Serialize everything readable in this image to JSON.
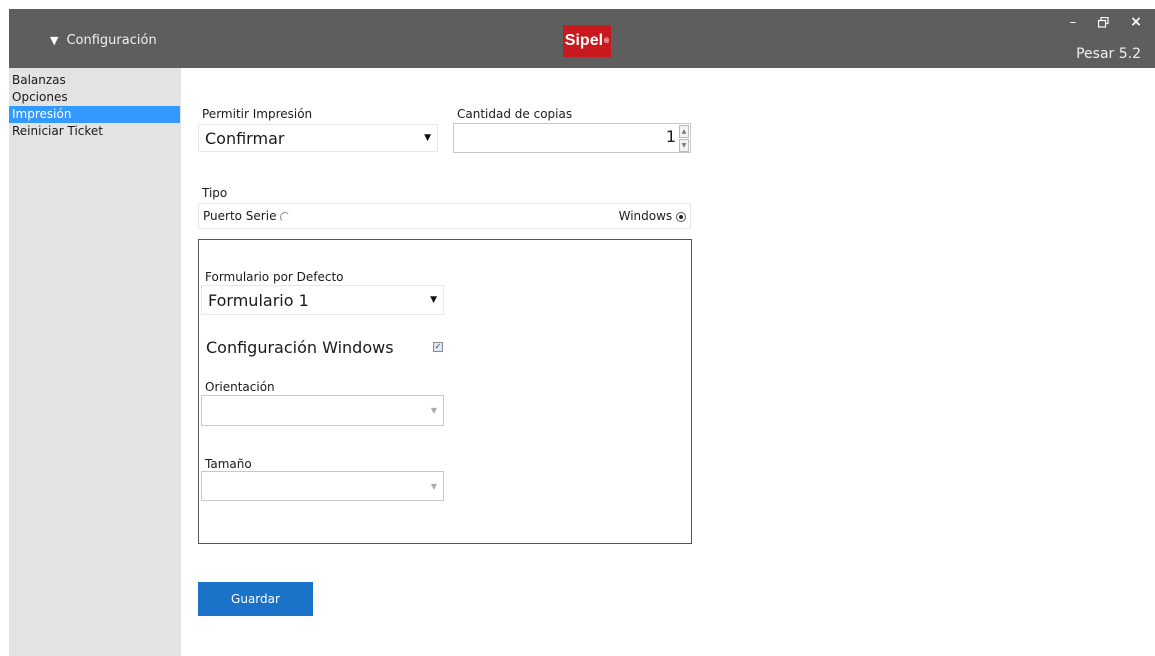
{
  "header": {
    "menu_label": "Configuración",
    "logo_text": "Sipel",
    "version": "Pesar 5.2",
    "window_controls": {
      "minimize": "–",
      "restore": "🗗",
      "close": "×"
    }
  },
  "sidebar": {
    "items": [
      {
        "label": "Balanzas"
      },
      {
        "label": "Opciones"
      },
      {
        "label": "Impresión"
      },
      {
        "label": "Reiniciar Ticket"
      }
    ],
    "active_index": 2
  },
  "form": {
    "permitir_impresion": {
      "label": "Permitir Impresión",
      "value": "Confirmar"
    },
    "cantidad_copias": {
      "label": "Cantidad de copias",
      "value": "1"
    },
    "tipo": {
      "label": "Tipo",
      "options": [
        {
          "label": "Puerto Serie",
          "selected": false
        },
        {
          "label": "Windows",
          "selected": true
        }
      ]
    },
    "formulario": {
      "label": "Formulario por Defecto",
      "value": "Formulario 1"
    },
    "configuracion_windows": {
      "label": "Configuración Windows",
      "checked": true
    },
    "orientacion": {
      "label": "Orientación",
      "value": ""
    },
    "tamano": {
      "label": "Tamaño",
      "value": ""
    }
  },
  "actions": {
    "save_label": "Guardar"
  },
  "colors": {
    "titlebar": "#5e5e5e",
    "sidebar": "#e3e3e3",
    "active_item": "#3399ff",
    "brand_red": "#c8191f",
    "primary_button": "#1a73c8"
  }
}
